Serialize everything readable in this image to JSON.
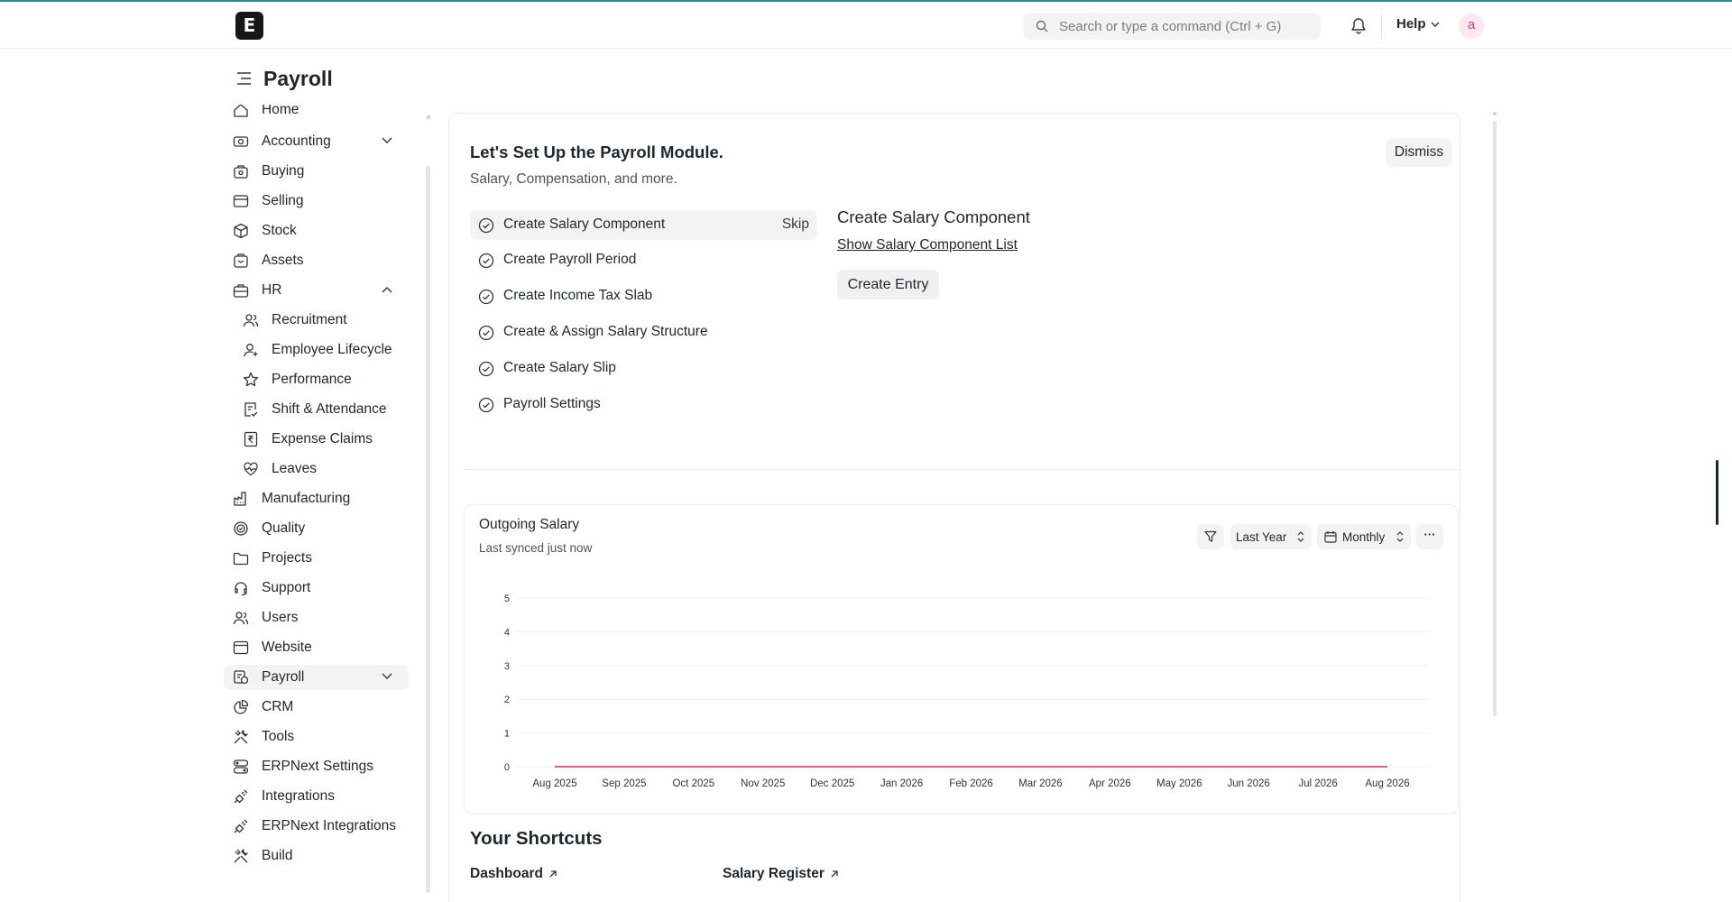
{
  "navbar": {
    "logo": "E",
    "search_placeholder": "Search or type a command (Ctrl + G)",
    "help_label": "Help",
    "avatar_initial": "a"
  },
  "page": {
    "title": "Payroll"
  },
  "sidebar": {
    "items": [
      {
        "label": "Home"
      },
      {
        "label": "Accounting"
      },
      {
        "label": "Buying"
      },
      {
        "label": "Selling"
      },
      {
        "label": "Stock"
      },
      {
        "label": "Assets"
      },
      {
        "label": "HR"
      },
      {
        "label": "Recruitment"
      },
      {
        "label": "Employee Lifecycle"
      },
      {
        "label": "Performance"
      },
      {
        "label": "Shift & Attendance"
      },
      {
        "label": "Expense Claims"
      },
      {
        "label": "Leaves"
      },
      {
        "label": "Manufacturing"
      },
      {
        "label": "Quality"
      },
      {
        "label": "Projects"
      },
      {
        "label": "Support"
      },
      {
        "label": "Users"
      },
      {
        "label": "Website"
      },
      {
        "label": "Payroll"
      },
      {
        "label": "CRM"
      },
      {
        "label": "Tools"
      },
      {
        "label": "ERPNext Settings"
      },
      {
        "label": "Integrations"
      },
      {
        "label": "ERPNext Integrations"
      },
      {
        "label": "Build"
      }
    ]
  },
  "onboarding": {
    "title": "Let's Set Up the Payroll Module.",
    "subtitle": "Salary, Compensation, and more.",
    "dismiss_label": "Dismiss",
    "skip_label": "Skip",
    "steps": [
      {
        "label": "Create Salary Component"
      },
      {
        "label": "Create Payroll Period"
      },
      {
        "label": "Create Income Tax Slab"
      },
      {
        "label": "Create & Assign Salary Structure"
      },
      {
        "label": "Create Salary Slip"
      },
      {
        "label": "Payroll Settings"
      }
    ],
    "detail": {
      "title": "Create Salary Component",
      "link": "Show Salary Component List",
      "button": "Create Entry"
    }
  },
  "chart_card": {
    "title": "Outgoing Salary",
    "sync_status": "Last synced just now",
    "range_label": "Last Year",
    "interval_label": "Monthly",
    "more_label": "···"
  },
  "chart_data": {
    "type": "line",
    "categories": [
      "Aug 2025",
      "Sep 2025",
      "Oct 2025",
      "Nov 2025",
      "Dec 2025",
      "Jan 2026",
      "Feb 2026",
      "Mar 2026",
      "Apr 2026",
      "May 2026",
      "Jun 2026",
      "Jul 2026",
      "Aug 2026"
    ],
    "series": [
      {
        "values": [
          0,
          0,
          0,
          0,
          0,
          0,
          0,
          0,
          0,
          0,
          0,
          0,
          0
        ],
        "color": "#e05a8a"
      }
    ],
    "y_ticks": [
      0,
      1,
      2,
      3,
      4,
      5
    ],
    "ylim": [
      0,
      5
    ],
    "grid": true
  },
  "shortcuts": {
    "title": "Your Shortcuts",
    "items": [
      {
        "label": "Dashboard"
      },
      {
        "label": "Salary Register"
      }
    ]
  }
}
